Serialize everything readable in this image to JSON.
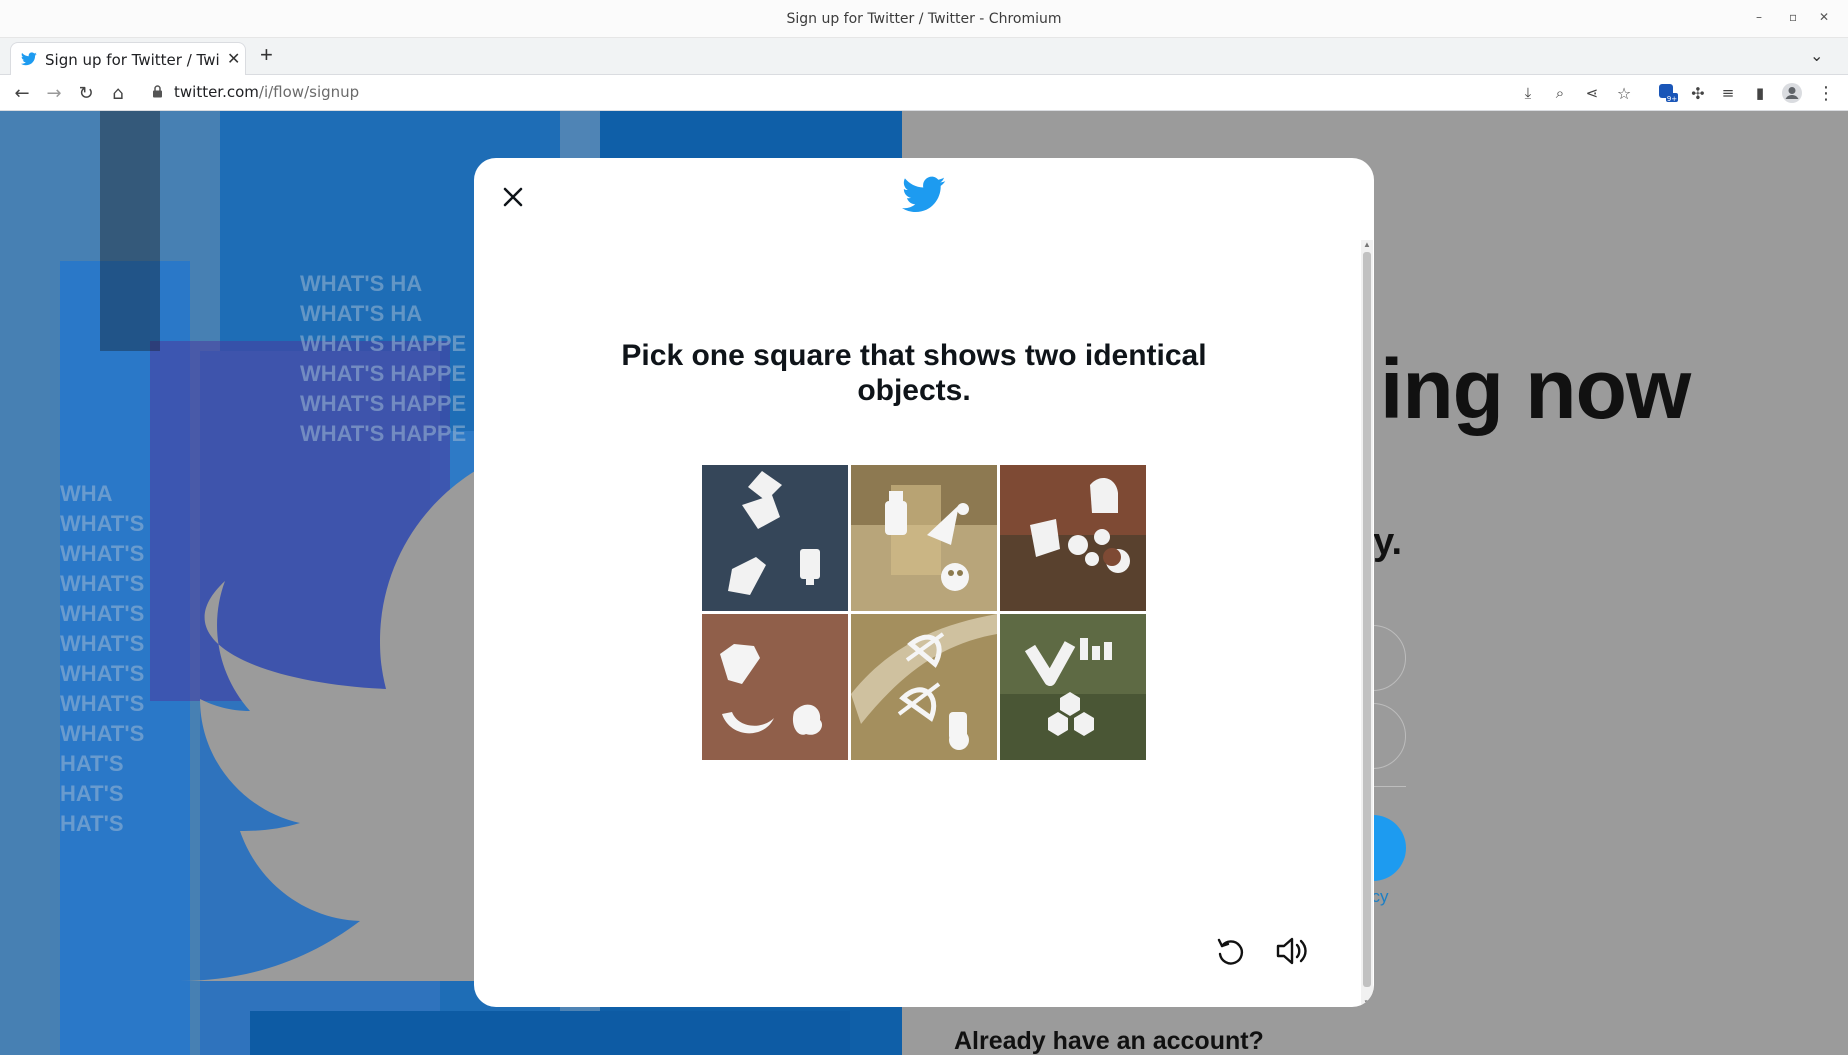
{
  "window": {
    "title": "Sign up for Twitter / Twitter - Chromium",
    "controls": [
      "minimize-icon",
      "restore-icon",
      "close-icon"
    ]
  },
  "tabs": [
    {
      "label": "Sign up for Twitter / Twitter",
      "favicon": "twitter-bird-icon",
      "active": true
    }
  ],
  "toolbar": {
    "url_host": "twitter.com",
    "url_path": "/i/flow/signup",
    "icons": [
      "back-icon",
      "forward-icon",
      "reload-icon",
      "home-icon",
      "install-icon",
      "zoom-icon",
      "share-icon",
      "bookmark-star-icon",
      "extension-badge-icon",
      "extensions-puzzle-icon",
      "media-icon",
      "side-panel-icon",
      "profile-icon",
      "menu-icon"
    ],
    "badge": "9+"
  },
  "background_page": {
    "headline_partial": "ing now",
    "subheadline_partial": "ay.",
    "link_partial": "acy",
    "already": "Already have an account?"
  },
  "modal": {
    "prompt": "Pick one square that shows two identical objects.",
    "tiles": [
      {
        "id": 1,
        "bg": "#3b4e63",
        "objects": [
          "diamond-stack",
          "striped-shard",
          "bottle"
        ]
      },
      {
        "id": 2,
        "bg": "#b8a57a",
        "objects": [
          "bottle",
          "sparkle",
          "face"
        ]
      },
      {
        "id": 3,
        "bg": "#7e4a34",
        "objects": [
          "knight",
          "shield",
          "molecule",
          "moon"
        ]
      },
      {
        "id": 4,
        "bg": "#9b6a54",
        "objects": [
          "gem",
          "crescent",
          "duck"
        ]
      },
      {
        "id": 5,
        "bg": "#a48f5e",
        "objects": [
          "bow-arrow",
          "bow-arrow",
          "flask"
        ]
      },
      {
        "id": 6,
        "bg": "#5e6a44",
        "objects": [
          "chevron",
          "skyline",
          "hexagons"
        ]
      }
    ],
    "actions": [
      "refresh-icon",
      "audio-icon"
    ],
    "colors": {
      "twitter_blue": "#1d9bf0",
      "text": "#0f1419"
    }
  }
}
